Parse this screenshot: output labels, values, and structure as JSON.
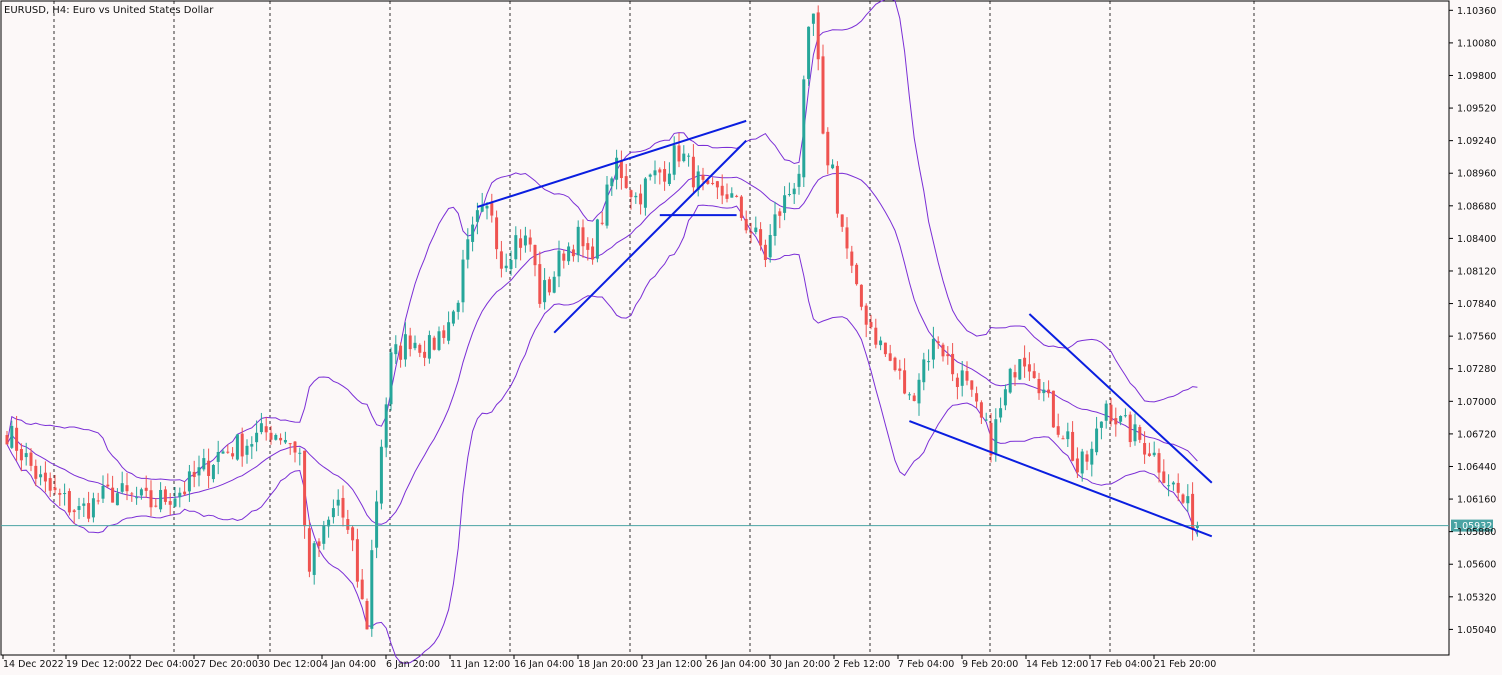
{
  "chart_title": "EURUSD, H4:  Euro vs United States Dollar",
  "colors": {
    "background": "#fcf8f8",
    "bull_candle": "#26a69a",
    "bear_candle": "#ef5350",
    "bands": "#7b2fd6",
    "trendlines": "#0a1ee0",
    "current_price_line": "#4aa3a3",
    "separator": "#000000"
  },
  "chart_data": {
    "type": "candlestick",
    "symbol": "EURUSD",
    "timeframe": "H4",
    "ylim": [
      1.0482,
      1.1044
    ],
    "y_ticks": [
      "1.10360",
      "1.10080",
      "1.09800",
      "1.09520",
      "1.09240",
      "1.08960",
      "1.08680",
      "1.08400",
      "1.08120",
      "1.07840",
      "1.07560",
      "1.07280",
      "1.07000",
      "1.06720",
      "1.06440",
      "1.06160",
      "1.05880",
      "1.05600",
      "1.05320",
      "1.05040"
    ],
    "x_ticks": [
      "14 Dec 2022",
      "19 Dec 12:00",
      "22 Dec 04:00",
      "27 Dec 20:00",
      "30 Dec 12:00",
      "4 Jan 04:00",
      "6 Jan 20:00",
      "11 Jan 12:00",
      "16 Jan 04:00",
      "18 Jan 20:00",
      "23 Jan 12:00",
      "26 Jan 04:00",
      "30 Jan 20:00",
      "2 Feb 12:00",
      "7 Feb 04:00",
      "9 Feb 20:00",
      "14 Feb 12:00",
      "17 Feb 04:00",
      "21 Feb 20:00"
    ],
    "current_price": "1.05932",
    "grid": false,
    "indicators": [
      "bollinger-bands"
    ],
    "candle_count": 249,
    "close_path": [
      [
        0,
        1.0675
      ],
      [
        8,
        1.0625
      ],
      [
        15,
        1.0605
      ],
      [
        22,
        1.0622
      ],
      [
        30,
        1.0612
      ],
      [
        37,
        1.0625
      ],
      [
        44,
        1.0655
      ],
      [
        50,
        1.0665
      ],
      [
        55,
        1.0675
      ],
      [
        58,
        1.067
      ],
      [
        61,
        1.0655
      ],
      [
        62,
        1.059
      ],
      [
        63,
        1.056
      ],
      [
        66,
        1.0585
      ],
      [
        69,
        1.0615
      ],
      [
        72,
        1.057
      ],
      [
        74,
        1.0525
      ],
      [
        75,
        1.051
      ],
      [
        76,
        1.057
      ],
      [
        78,
        1.0665
      ],
      [
        80,
        1.0735
      ],
      [
        84,
        1.0755
      ],
      [
        88,
        1.0745
      ],
      [
        93,
        1.0775
      ],
      [
        96,
        1.083
      ],
      [
        98,
        1.0855
      ],
      [
        101,
        1.0865
      ],
      [
        103,
        1.082
      ],
      [
        106,
        1.084
      ],
      [
        109,
        1.0835
      ],
      [
        111,
        1.079
      ],
      [
        113,
        1.08
      ],
      [
        116,
        1.083
      ],
      [
        119,
        1.084
      ],
      [
        121,
        1.082
      ],
      [
        124,
        1.086
      ],
      [
        127,
        1.0905
      ],
      [
        131,
        1.0875
      ],
      [
        134,
        1.089
      ],
      [
        137,
        1.09
      ],
      [
        140,
        1.0915
      ],
      [
        143,
        1.0895
      ],
      [
        146,
        1.0875
      ],
      [
        150,
        1.088
      ],
      [
        153,
        1.086
      ],
      [
        156,
        1.084
      ],
      [
        158,
        1.0825
      ],
      [
        160,
        1.0855
      ],
      [
        163,
        1.088
      ],
      [
        165,
        1.09
      ],
      [
        166,
        1.0965
      ],
      [
        167,
        1.101
      ],
      [
        168,
        1.103
      ],
      [
        169,
        1.0985
      ],
      [
        170,
        1.092
      ],
      [
        172,
        1.09
      ],
      [
        173,
        1.087
      ],
      [
        175,
        1.083
      ],
      [
        177,
        1.079
      ],
      [
        180,
        1.0765
      ],
      [
        183,
        1.074
      ],
      [
        186,
        1.072
      ],
      [
        188,
        1.07
      ],
      [
        191,
        1.0735
      ],
      [
        194,
        1.0755
      ],
      [
        197,
        1.0725
      ],
      [
        199,
        1.072
      ],
      [
        202,
        1.069
      ],
      [
        205,
        1.0665
      ],
      [
        208,
        1.0705
      ],
      [
        211,
        1.0745
      ],
      [
        214,
        1.073
      ],
      [
        218,
        1.0685
      ],
      [
        221,
        1.067
      ],
      [
        223,
        1.064
      ],
      [
        226,
        1.0655
      ],
      [
        229,
        1.07
      ],
      [
        232,
        1.068
      ],
      [
        235,
        1.067
      ],
      [
        238,
        1.066
      ],
      [
        241,
        1.064
      ],
      [
        244,
        1.062
      ],
      [
        247,
        1.06
      ],
      [
        248,
        1.0595
      ]
    ]
  }
}
